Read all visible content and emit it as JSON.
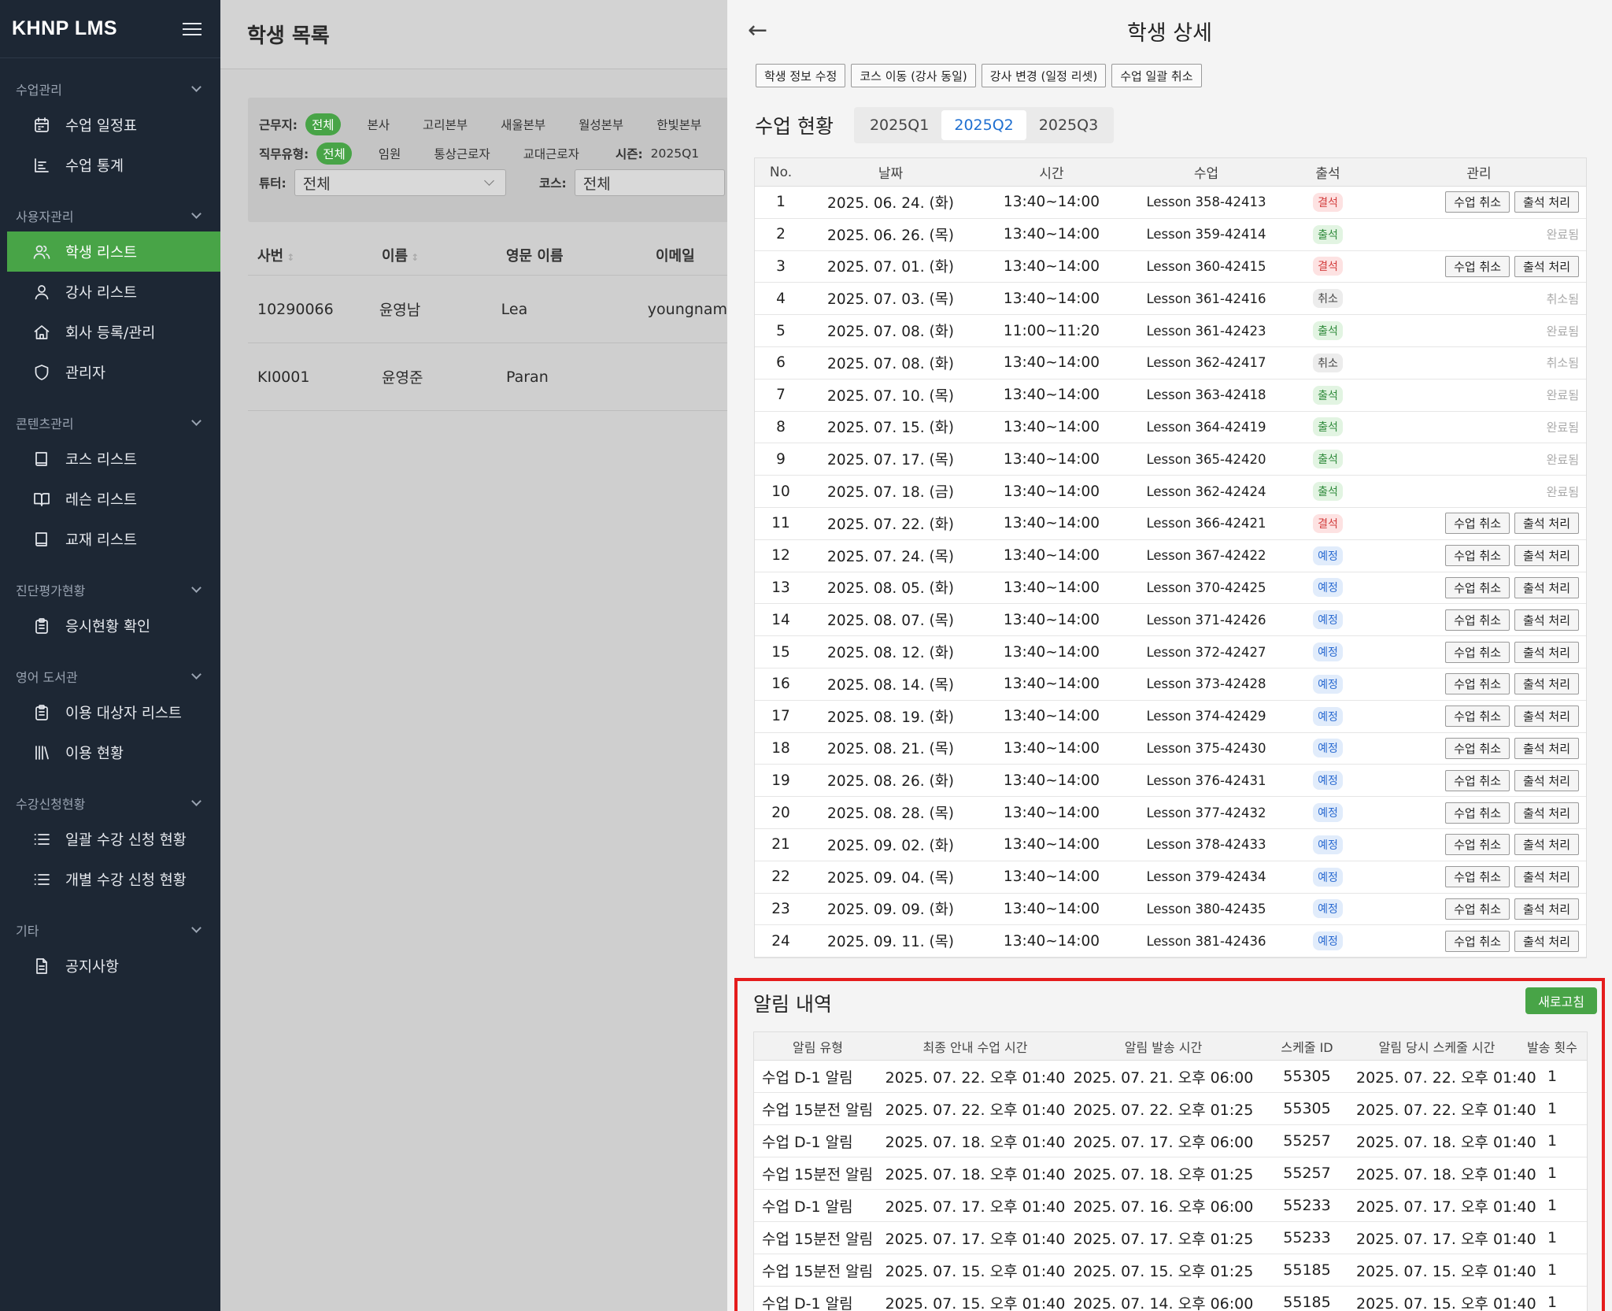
{
  "app": {
    "logo": "KHNP LMS"
  },
  "sidebar": {
    "sections": [
      {
        "title": "수업관리",
        "items": [
          {
            "label": "수업 일정표",
            "icon": "calendar-icon"
          },
          {
            "label": "수업 통계",
            "icon": "chart-icon"
          }
        ]
      },
      {
        "title": "사용자관리",
        "items": [
          {
            "label": "학생 리스트",
            "icon": "users-icon",
            "active": true
          },
          {
            "label": "강사 리스트",
            "icon": "user-icon"
          },
          {
            "label": "회사 등록/관리",
            "icon": "home-icon"
          },
          {
            "label": "관리자",
            "icon": "shield-icon"
          }
        ]
      },
      {
        "title": "콘텐츠관리",
        "items": [
          {
            "label": "코스 리스트",
            "icon": "book-icon"
          },
          {
            "label": "레슨 리스트",
            "icon": "book-open-icon"
          },
          {
            "label": "교재 리스트",
            "icon": "book-icon"
          }
        ]
      },
      {
        "title": "진단평가현황",
        "items": [
          {
            "label": "응시현황 확인",
            "icon": "clipboard-icon"
          }
        ]
      },
      {
        "title": "영어 도서관",
        "items": [
          {
            "label": "이용 대상자 리스트",
            "icon": "clipboard-icon"
          },
          {
            "label": "이용 현황",
            "icon": "library-icon"
          }
        ]
      },
      {
        "title": "수강신청현황",
        "items": [
          {
            "label": "일괄 수강 신청 현황",
            "icon": "list-icon"
          },
          {
            "label": "개별 수강 신청 현황",
            "icon": "list-icon"
          }
        ]
      },
      {
        "title": "기타",
        "items": [
          {
            "label": "공지사항",
            "icon": "document-icon"
          }
        ]
      }
    ]
  },
  "main": {
    "title": "학생 목록",
    "filters": {
      "workplace_label": "근무지:",
      "workplace_options": [
        "전체",
        "본사",
        "고리본부",
        "새울본부",
        "월성본부",
        "한빛본부"
      ],
      "jobtype_label": "직무유형:",
      "jobtype_options": [
        "전체",
        "임원",
        "통상근로자",
        "교대근로자"
      ],
      "season_label": "시즌:",
      "season_value": "2025Q1",
      "tutor_label": "튜터:",
      "tutor_value": "전체",
      "course_label": "코스:",
      "course_value": "전체"
    },
    "columns": [
      "사번",
      "이름",
      "영문 이름",
      "이메일"
    ],
    "rows": [
      [
        "10290066",
        "윤영남",
        "Lea",
        "youngnam"
      ],
      [
        "KI0001",
        "윤영준",
        "Paran",
        ""
      ]
    ]
  },
  "detail": {
    "title": "학생 상세",
    "actions": [
      "학생 정보 수정",
      "코스 이동 (강사 동일)",
      "강사 변경 (일정 리셋)",
      "수업 일괄 취소"
    ],
    "status_title": "수업 현황",
    "seasons": [
      "2025Q1",
      "2025Q2",
      "2025Q3"
    ],
    "active_season": "2025Q2",
    "schedule_columns": [
      "No.",
      "날짜",
      "시간",
      "수업",
      "출석",
      "관리"
    ],
    "cancel_label": "수업 취소",
    "attend_label": "출석 처리",
    "schedule": [
      {
        "no": "1",
        "date": "2025. 06. 24. (화)",
        "time": "13:40~14:00",
        "lesson": "Lesson 358-42413",
        "att": "결석",
        "kind": "absent",
        "mgmt": "buttons"
      },
      {
        "no": "2",
        "date": "2025. 06. 26. (목)",
        "time": "13:40~14:00",
        "lesson": "Lesson 359-42414",
        "att": "출석",
        "kind": "present",
        "mgmt": "완료됨"
      },
      {
        "no": "3",
        "date": "2025. 07. 01. (화)",
        "time": "13:40~14:00",
        "lesson": "Lesson 360-42415",
        "att": "결석",
        "kind": "absent",
        "mgmt": "buttons"
      },
      {
        "no": "4",
        "date": "2025. 07. 03. (목)",
        "time": "13:40~14:00",
        "lesson": "Lesson 361-42416",
        "att": "취소",
        "kind": "cancel",
        "mgmt": "취소됨"
      },
      {
        "no": "5",
        "date": "2025. 07. 08. (화)",
        "time": "11:00~11:20",
        "lesson": "Lesson 361-42423",
        "att": "출석",
        "kind": "present",
        "mgmt": "완료됨"
      },
      {
        "no": "6",
        "date": "2025. 07. 08. (화)",
        "time": "13:40~14:00",
        "lesson": "Lesson 362-42417",
        "att": "취소",
        "kind": "cancel",
        "mgmt": "취소됨"
      },
      {
        "no": "7",
        "date": "2025. 07. 10. (목)",
        "time": "13:40~14:00",
        "lesson": "Lesson 363-42418",
        "att": "출석",
        "kind": "present",
        "mgmt": "완료됨"
      },
      {
        "no": "8",
        "date": "2025. 07. 15. (화)",
        "time": "13:40~14:00",
        "lesson": "Lesson 364-42419",
        "att": "출석",
        "kind": "present",
        "mgmt": "완료됨"
      },
      {
        "no": "9",
        "date": "2025. 07. 17. (목)",
        "time": "13:40~14:00",
        "lesson": "Lesson 365-42420",
        "att": "출석",
        "kind": "present",
        "mgmt": "완료됨"
      },
      {
        "no": "10",
        "date": "2025. 07. 18. (금)",
        "time": "13:40~14:00",
        "lesson": "Lesson 362-42424",
        "att": "출석",
        "kind": "present",
        "mgmt": "완료됨"
      },
      {
        "no": "11",
        "date": "2025. 07. 22. (화)",
        "time": "13:40~14:00",
        "lesson": "Lesson 366-42421",
        "att": "결석",
        "kind": "absent",
        "mgmt": "buttons"
      },
      {
        "no": "12",
        "date": "2025. 07. 24. (목)",
        "time": "13:40~14:00",
        "lesson": "Lesson 367-42422",
        "att": "예정",
        "kind": "planned",
        "mgmt": "buttons"
      },
      {
        "no": "13",
        "date": "2025. 08. 05. (화)",
        "time": "13:40~14:00",
        "lesson": "Lesson 370-42425",
        "att": "예정",
        "kind": "planned",
        "mgmt": "buttons"
      },
      {
        "no": "14",
        "date": "2025. 08. 07. (목)",
        "time": "13:40~14:00",
        "lesson": "Lesson 371-42426",
        "att": "예정",
        "kind": "planned",
        "mgmt": "buttons"
      },
      {
        "no": "15",
        "date": "2025. 08. 12. (화)",
        "time": "13:40~14:00",
        "lesson": "Lesson 372-42427",
        "att": "예정",
        "kind": "planned",
        "mgmt": "buttons"
      },
      {
        "no": "16",
        "date": "2025. 08. 14. (목)",
        "time": "13:40~14:00",
        "lesson": "Lesson 373-42428",
        "att": "예정",
        "kind": "planned",
        "mgmt": "buttons"
      },
      {
        "no": "17",
        "date": "2025. 08. 19. (화)",
        "time": "13:40~14:00",
        "lesson": "Lesson 374-42429",
        "att": "예정",
        "kind": "planned",
        "mgmt": "buttons"
      },
      {
        "no": "18",
        "date": "2025. 08. 21. (목)",
        "time": "13:40~14:00",
        "lesson": "Lesson 375-42430",
        "att": "예정",
        "kind": "planned",
        "mgmt": "buttons"
      },
      {
        "no": "19",
        "date": "2025. 08. 26. (화)",
        "time": "13:40~14:00",
        "lesson": "Lesson 376-42431",
        "att": "예정",
        "kind": "planned",
        "mgmt": "buttons"
      },
      {
        "no": "20",
        "date": "2025. 08. 28. (목)",
        "time": "13:40~14:00",
        "lesson": "Lesson 377-42432",
        "att": "예정",
        "kind": "planned",
        "mgmt": "buttons"
      },
      {
        "no": "21",
        "date": "2025. 09. 02. (화)",
        "time": "13:40~14:00",
        "lesson": "Lesson 378-42433",
        "att": "예정",
        "kind": "planned",
        "mgmt": "buttons"
      },
      {
        "no": "22",
        "date": "2025. 09. 04. (목)",
        "time": "13:40~14:00",
        "lesson": "Lesson 379-42434",
        "att": "예정",
        "kind": "planned",
        "mgmt": "buttons"
      },
      {
        "no": "23",
        "date": "2025. 09. 09. (화)",
        "time": "13:40~14:00",
        "lesson": "Lesson 380-42435",
        "att": "예정",
        "kind": "planned",
        "mgmt": "buttons"
      },
      {
        "no": "24",
        "date": "2025. 09. 11. (목)",
        "time": "13:40~14:00",
        "lesson": "Lesson 381-42436",
        "att": "예정",
        "kind": "planned",
        "mgmt": "buttons"
      }
    ],
    "notif": {
      "title": "알림 내역",
      "refresh_label": "새로고침",
      "columns": [
        "알림 유형",
        "최종 안내 수업 시간",
        "알림 발송 시간",
        "스케줄 ID",
        "알림 당시 스케줄 시간",
        "발송 횟수"
      ],
      "rows": [
        [
          "수업 D-1 알림",
          "2025. 07. 22. 오후 01:40",
          "2025. 07. 21. 오후 06:00",
          "55305",
          "2025. 07. 22. 오후 01:40",
          "1"
        ],
        [
          "수업 15분전 알림",
          "2025. 07. 22. 오후 01:40",
          "2025. 07. 22. 오후 01:25",
          "55305",
          "2025. 07. 22. 오후 01:40",
          "1"
        ],
        [
          "수업 D-1 알림",
          "2025. 07. 18. 오후 01:40",
          "2025. 07. 17. 오후 06:00",
          "55257",
          "2025. 07. 18. 오후 01:40",
          "1"
        ],
        [
          "수업 15분전 알림",
          "2025. 07. 18. 오후 01:40",
          "2025. 07. 18. 오후 01:25",
          "55257",
          "2025. 07. 18. 오후 01:40",
          "1"
        ],
        [
          "수업 D-1 알림",
          "2025. 07. 17. 오후 01:40",
          "2025. 07. 16. 오후 06:00",
          "55233",
          "2025. 07. 17. 오후 01:40",
          "1"
        ],
        [
          "수업 15분전 알림",
          "2025. 07. 17. 오후 01:40",
          "2025. 07. 17. 오후 01:25",
          "55233",
          "2025. 07. 17. 오후 01:40",
          "1"
        ],
        [
          "수업 15분전 알림",
          "2025. 07. 15. 오후 01:40",
          "2025. 07. 15. 오후 01:25",
          "55185",
          "2025. 07. 15. 오후 01:40",
          "1"
        ],
        [
          "수업 D-1 알림",
          "2025. 07. 15. 오후 01:40",
          "2025. 07. 14. 오후 06:00",
          "55185",
          "2025. 07. 15. 오후 01:40",
          "1"
        ]
      ]
    }
  },
  "colors": {
    "accent": "#48a447",
    "sidebar": "#1d2734",
    "highlight_border": "#e51c1c"
  }
}
